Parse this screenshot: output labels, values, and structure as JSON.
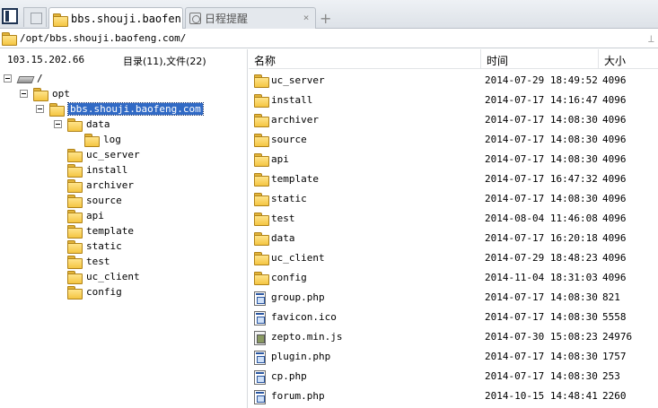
{
  "tabs": [
    {
      "label": "bbs.shouji.baofen...",
      "active": true
    },
    {
      "label": "日程提醒",
      "active": false
    }
  ],
  "tab_add": "+",
  "tab_close": "×",
  "address": {
    "path": "/opt/bbs.shouji.baofeng.com/",
    "pin": "⊥"
  },
  "left": {
    "ip": "103.15.202.66",
    "count": "目录(11),文件(22)",
    "tree": {
      "root": "/",
      "opt": "opt",
      "selected": "bbs.shouji.baofeng.com",
      "data": "data",
      "log": "log",
      "children": [
        "uc_server",
        "install",
        "archiver",
        "source",
        "api",
        "template",
        "static",
        "test",
        "uc_client",
        "config"
      ]
    }
  },
  "columns": {
    "name": "名称",
    "time": "时间",
    "size": "大小"
  },
  "files": [
    {
      "name": "uc_server",
      "time": "2014-07-29 18:49:52",
      "size": "4096",
      "type": "folder"
    },
    {
      "name": "install",
      "time": "2014-07-17 14:16:47",
      "size": "4096",
      "type": "folder"
    },
    {
      "name": "archiver",
      "time": "2014-07-17 14:08:30",
      "size": "4096",
      "type": "folder"
    },
    {
      "name": "source",
      "time": "2014-07-17 14:08:30",
      "size": "4096",
      "type": "folder"
    },
    {
      "name": "api",
      "time": "2014-07-17 14:08:30",
      "size": "4096",
      "type": "folder"
    },
    {
      "name": "template",
      "time": "2014-07-17 16:47:32",
      "size": "4096",
      "type": "folder"
    },
    {
      "name": "static",
      "time": "2014-07-17 14:08:30",
      "size": "4096",
      "type": "folder"
    },
    {
      "name": "test",
      "time": "2014-08-04 11:46:08",
      "size": "4096",
      "type": "folder"
    },
    {
      "name": "data",
      "time": "2014-07-17 16:20:18",
      "size": "4096",
      "type": "folder"
    },
    {
      "name": "uc_client",
      "time": "2014-07-29 18:48:23",
      "size": "4096",
      "type": "folder"
    },
    {
      "name": "config",
      "time": "2014-11-04 18:31:03",
      "size": "4096",
      "type": "folder"
    },
    {
      "name": "group.php",
      "time": "2014-07-17 14:08:30",
      "size": "821",
      "type": "php"
    },
    {
      "name": "favicon.ico",
      "time": "2014-07-17 14:08:30",
      "size": "5558",
      "type": "php"
    },
    {
      "name": "zepto.min.js",
      "time": "2014-07-30 15:08:23",
      "size": "24976",
      "type": "js"
    },
    {
      "name": "plugin.php",
      "time": "2014-07-17 14:08:30",
      "size": "1757",
      "type": "php"
    },
    {
      "name": "cp.php",
      "time": "2014-07-17 14:08:30",
      "size": "253",
      "type": "php"
    },
    {
      "name": "forum.php",
      "time": "2014-10-15 14:48:41",
      "size": "2260",
      "type": "php"
    }
  ],
  "colors": {
    "selection": "#316ac5",
    "folder": "#f4c542"
  }
}
